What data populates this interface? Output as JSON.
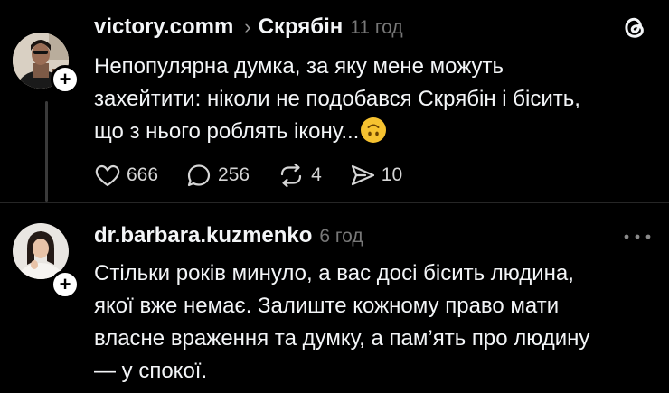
{
  "post1": {
    "username": "victory.comm",
    "topic": "Скрябін",
    "time": "11 год",
    "text_lines": [
      "Непопулярна думка, за яку мене можуть",
      "захейтити: ніколи не подобався Скрябін і бісить,",
      "що з нього роблять ікону..."
    ],
    "emoji_icon": "upside-down-face",
    "likes": "666",
    "comments": "256",
    "reposts": "4",
    "shares": "10"
  },
  "post2": {
    "username": "dr.barbara.kuzmenko",
    "time": "6 год",
    "text_lines": [
      "Стільки років минуло, а вас досі бісить людина,",
      "якої вже немає. Залиште кожному право мати",
      "власне враження та думку, а пам’ять про людину",
      "— у спокої."
    ]
  },
  "icons": {
    "chevron": "›",
    "plus": "+"
  },
  "colors": {
    "background": "#000000",
    "text": "#f3f5f7",
    "muted": "#777777"
  }
}
